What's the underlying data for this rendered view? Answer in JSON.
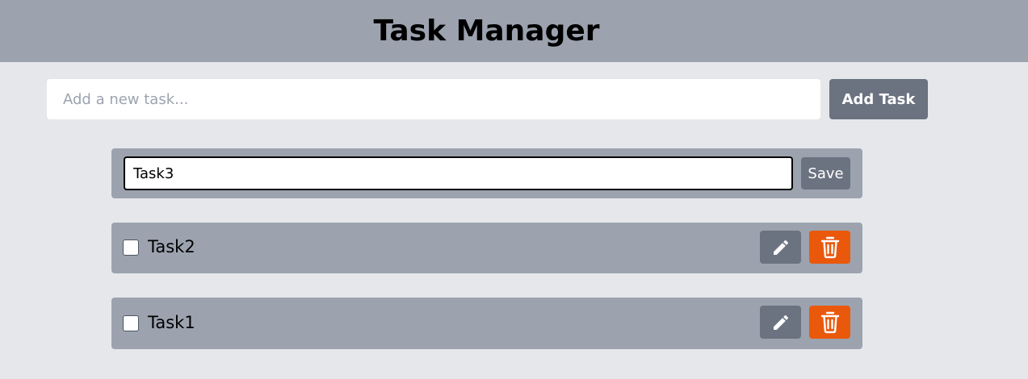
{
  "header": {
    "title": "Task Manager"
  },
  "new_task": {
    "placeholder": "Add a new task...",
    "value": "",
    "button_label": "Add Task"
  },
  "editing": {
    "value": "Task3",
    "save_label": "Save"
  },
  "tasks": [
    {
      "label": "Task2",
      "checked": false
    },
    {
      "label": "Task1",
      "checked": false
    }
  ],
  "icons": {
    "edit": "pencil-icon",
    "delete": "trash-icon"
  },
  "colors": {
    "header_bg": "#9ca3af",
    "page_bg": "#e5e7eb",
    "button_gray": "#6b7280",
    "delete_orange": "#ea580c"
  }
}
